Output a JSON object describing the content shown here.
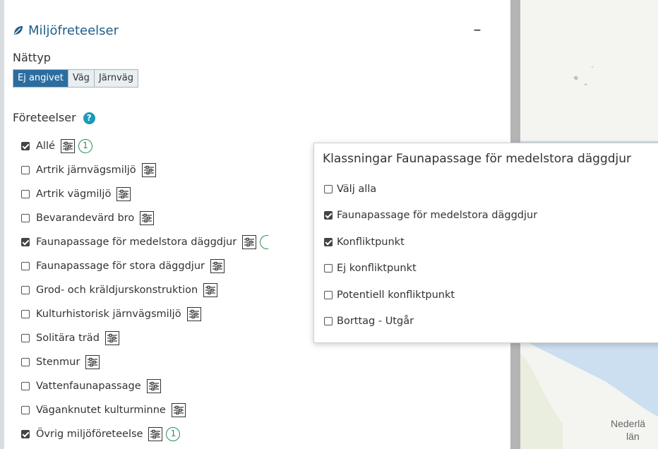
{
  "panel": {
    "title": "Miljöfreteelser",
    "minimize_symbol": "–",
    "network_label": "Nättyp",
    "network_options": [
      "Ej angivet",
      "Väg",
      "Järnväg"
    ],
    "phenomena_label": "Företeelser",
    "help_symbol": "?",
    "items": [
      {
        "label": "Allé",
        "checked": true,
        "count": "1"
      },
      {
        "label": "Artrik järnvägsmiljö",
        "checked": false
      },
      {
        "label": "Artrik vägmiljö",
        "checked": false
      },
      {
        "label": "Bevarandevärd bro",
        "checked": false
      },
      {
        "label": "Faunapassage för medelstora däggdjur",
        "checked": true
      },
      {
        "label": "Faunapassage för stora däggdjur",
        "checked": false
      },
      {
        "label": "Grod- och kräldjurskonstruktion",
        "checked": false
      },
      {
        "label": "Kulturhistorisk järnvägsmiljö",
        "checked": false
      },
      {
        "label": "Solitära träd",
        "checked": false
      },
      {
        "label": "Stenmur",
        "checked": false
      },
      {
        "label": "Vattenfaunapassage",
        "checked": false
      },
      {
        "label": "Väganknutet kulturminne",
        "checked": false
      },
      {
        "label": "Övrig miljöföreteelse",
        "checked": true,
        "count": "1"
      }
    ]
  },
  "popup": {
    "title": "Klassningar Faunapassage för medelstora däggdjur",
    "options": [
      {
        "label": "Välj alla",
        "checked": false
      },
      {
        "label": "Faunapassage för medelstora däggdjur",
        "checked": true
      },
      {
        "label": "Konfliktpunkt",
        "checked": true
      },
      {
        "label": "Ej konfliktpunkt",
        "checked": false
      },
      {
        "label": "Potentiell konfliktpunkt",
        "checked": false
      },
      {
        "label": "Borttag - Utgår",
        "checked": false
      }
    ]
  },
  "map": {
    "label_line1": "Nederlä",
    "label_line2": "län"
  },
  "colors": {
    "title": "#1f5e8a",
    "active_segment": "#2c6da0",
    "help": "#1a9ab8",
    "count_badge": "#2e8b57",
    "map_water": "#ccdff0"
  }
}
